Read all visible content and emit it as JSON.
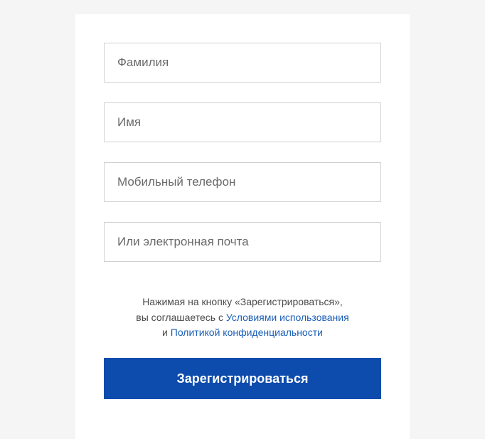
{
  "form": {
    "fields": {
      "surname": {
        "placeholder": "Фамилия",
        "value": ""
      },
      "name": {
        "placeholder": "Имя",
        "value": ""
      },
      "phone": {
        "placeholder": "Мобильный телефон",
        "value": ""
      },
      "email": {
        "placeholder": "Или электронная почта",
        "value": ""
      }
    },
    "consent": {
      "line1_prefix": "Нажимая на кнопку «Зарегистрироваться»,",
      "line2_prefix": "вы соглашаетесь с ",
      "terms_link": "Условиями использования",
      "line3_prefix": "и ",
      "privacy_link": "Политикой конфиденциальности"
    },
    "submit_label": "Зарегистрироваться"
  }
}
